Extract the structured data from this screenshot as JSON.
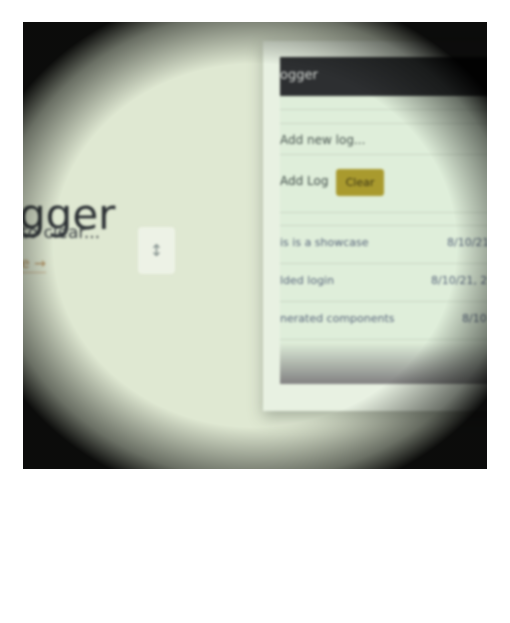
{
  "hero": {
    "title": "gger",
    "subtitle": "to clear...",
    "link": "e →"
  },
  "swap_button": {
    "glyph": "↕"
  },
  "app": {
    "title": "ogger",
    "new_log_placeholder": "Add new log...",
    "add_log_label": "Add Log",
    "clear_label": "Clear",
    "accent_color": "#a99a2e",
    "navbar_color": "#2d2f31",
    "logs": [
      {
        "text": "is is a showcase",
        "time": "8/10/21"
      },
      {
        "text": "lded login",
        "time": "8/10/21, 2"
      },
      {
        "text": "nerated components",
        "time": "8/10"
      }
    ]
  }
}
